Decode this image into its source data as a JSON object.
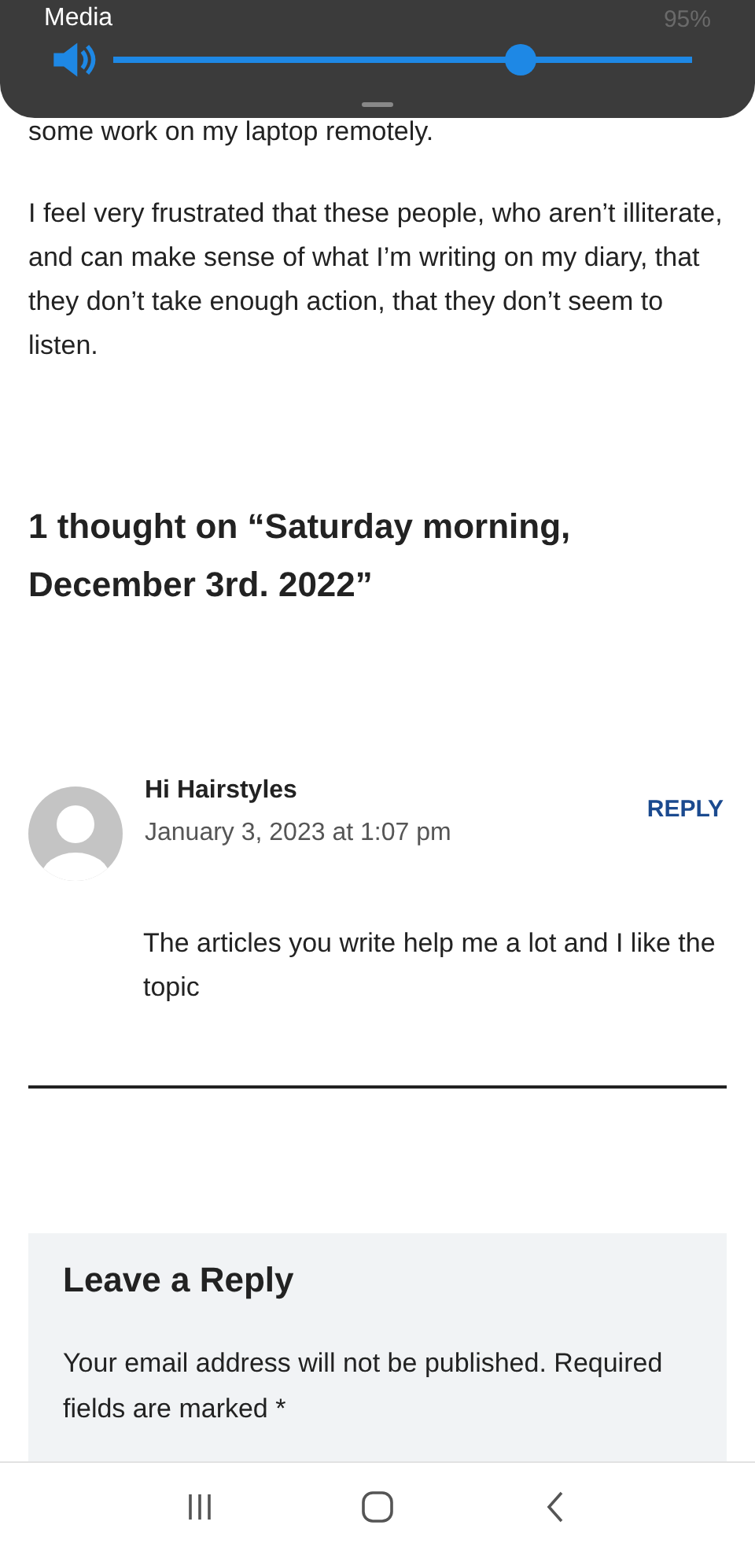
{
  "volume_panel": {
    "title": "Media",
    "battery": "95%"
  },
  "article": {
    "paragraphs": [
      "some work on my laptop remotely.",
      "I feel very frustrated that these people, who aren’t illiterate, and can make sense of what I’m writing on my diary, that they don’t take enough action, that they don’t seem to listen."
    ]
  },
  "comments": {
    "heading": "1 thought on “Saturday morning, December 3rd. 2022”",
    "items": [
      {
        "author": "Hi Hairstyles",
        "date": "January 3, 2023 at 1:07 pm",
        "reply": "REPLY",
        "text": "The articles you write help me a lot and I like the topic"
      }
    ]
  },
  "leave_reply": {
    "title": "Leave a Reply",
    "note": "Your email address will not be published. Required fields are marked *"
  }
}
